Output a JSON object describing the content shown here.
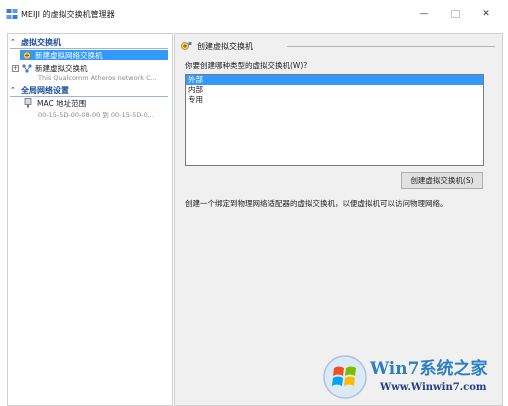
{
  "window": {
    "title": "MEIJI 的虚拟交换机管理器",
    "controls": {
      "minimize": "—",
      "close": "✕"
    }
  },
  "sidebar": {
    "section_switches": "虚拟交换机",
    "items": [
      {
        "label": "新建虚拟网络交换机",
        "selected": true
      },
      {
        "label": "新建虚拟交换机",
        "sub": "This Qualcomm Atheros network C..."
      }
    ],
    "section_global": "全局网络设置",
    "global_items": [
      {
        "label": "MAC 地址范围",
        "sub": "00-15-5D-00-08-00 到 00-15-5D-0..."
      }
    ]
  },
  "main": {
    "header": "创建虚拟交换机",
    "question": "你要创建哪种类型的虚拟交换机(W)?",
    "types": [
      {
        "label": "外部",
        "selected": true
      },
      {
        "label": "内部",
        "selected": false
      },
      {
        "label": "专用",
        "selected": false
      }
    ],
    "create_button": "创建虚拟交换机(S)",
    "description": "创建一个绑定到物理网络适配器的虚拟交换机，以便虚拟机可以访问物理网络。"
  },
  "watermark": {
    "brand": "Win7系统之家",
    "url": "Www.Winwin7.com"
  },
  "colors": {
    "selection": "#3399ff",
    "section_header": "#1b4f9c",
    "pane_background": "#f0f0f0"
  }
}
